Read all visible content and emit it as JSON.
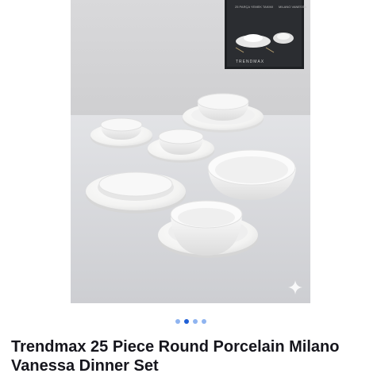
{
  "product": {
    "title": "Trendmax 25 Piece Round Porcelain Milano Vanessa Dinner Set"
  },
  "gallery": {
    "image_count": 4,
    "active_index": 1,
    "box_brand": "TRENDMAX",
    "box_caption": "25 PARÇA YEMEK TAKIMI",
    "box_series": "MILANO VANESSA"
  },
  "icons": {
    "sparkle": "sparkle-icon"
  },
  "colors": {
    "dot_active": "#1f5fd6",
    "dot_inactive": "#8fb4f0",
    "title": "#16161d"
  }
}
